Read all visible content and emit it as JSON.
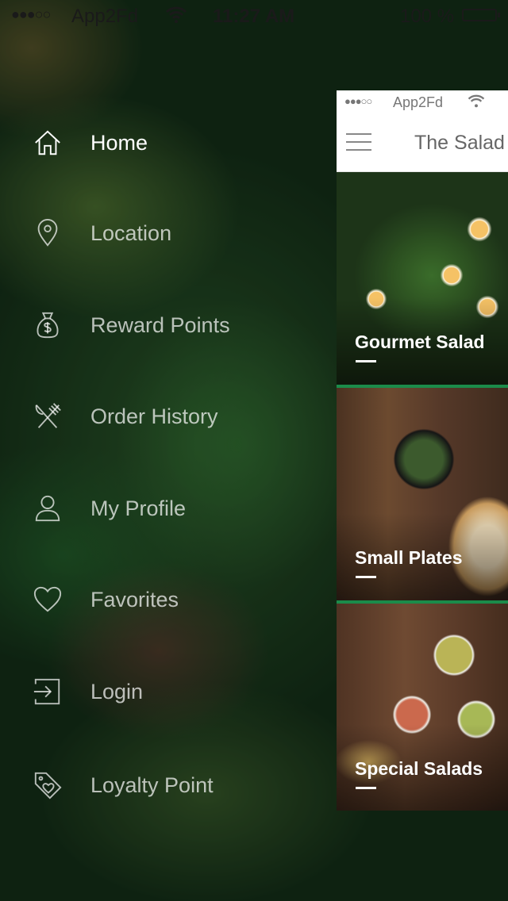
{
  "status_bar": {
    "signal": "●●●○○",
    "carrier": "App2Fd",
    "time": "11:27 AM",
    "battery": "100 %"
  },
  "menu": {
    "items": [
      {
        "label": "Home",
        "icon": "home-icon",
        "active": true
      },
      {
        "label": "Location",
        "icon": "location-pin-icon",
        "active": false
      },
      {
        "label": "Reward Points",
        "icon": "money-bag-icon",
        "active": false
      },
      {
        "label": "Order History",
        "icon": "fork-knife-icon",
        "active": false
      },
      {
        "label": "My Profile",
        "icon": "user-icon",
        "active": false
      },
      {
        "label": "Favorites",
        "icon": "heart-icon",
        "active": false
      },
      {
        "label": "Login",
        "icon": "login-icon",
        "active": false
      },
      {
        "label": "Loyalty Point",
        "icon": "tag-heart-icon",
        "active": false
      }
    ]
  },
  "preview": {
    "status": {
      "signal": "●●●○○",
      "carrier": "App2Fd"
    },
    "title": "The Salad",
    "cards": [
      {
        "label": "Gourmet Salad"
      },
      {
        "label": "Small Plates"
      },
      {
        "label": "Special Salads"
      }
    ]
  },
  "colors": {
    "accent_green": "#1f8a4c",
    "menu_text": "#ffffff"
  }
}
